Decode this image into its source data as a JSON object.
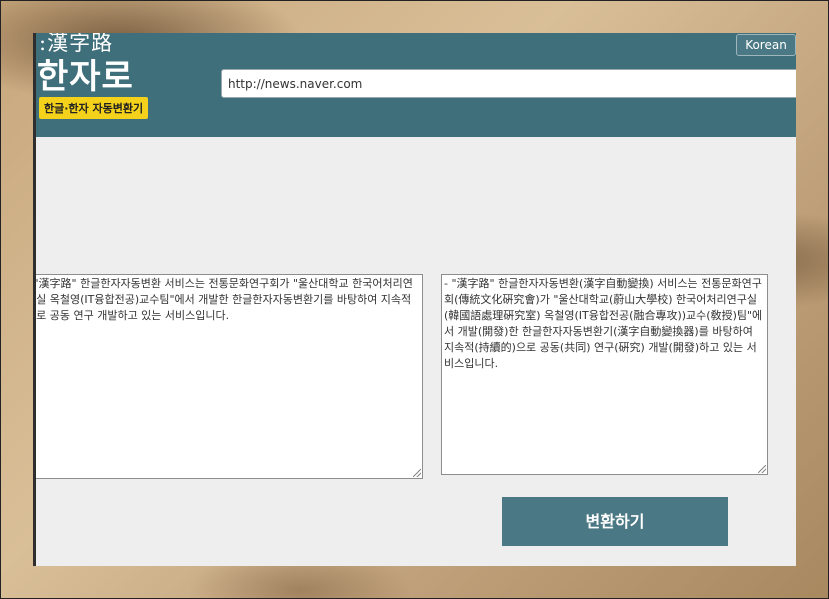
{
  "header": {
    "logo_hanja": ":漢字路",
    "logo_main": "한자로",
    "logo_badge": "한글·한자 자동변환기",
    "lang_button": "Korean"
  },
  "url": {
    "value": "http://news.naver.com"
  },
  "input_text": "- \"漢字路\" 한글한자자동변환 서비스는 전통문화연구회가 \"울산대학교 한국어처리연구실 옥철영(IT융합전공)교수팀\"에서 개발한 한글한자자동변환기를 바탕하여 지속적으로 공동 연구 개발하고 있는 서비스입니다.",
  "output_text": "- \"漢字路\" 한글한자자동변환(漢字自動變換) 서비스는 전통문화연구회(傳統文化硏究會)가 \"울산대학교(蔚山大學校) 한국어처리연구실(韓國語處理硏究室) 옥철영(IT융합전공(融合專攻))교수(敎授)팀\"에서 개발(開發)한 한글한자자동변환기(漢字自動變換器)를 바탕하여 지속적(持續的)으로 공동(共同) 연구(硏究) 개발(開發)하고 있는 서비스입니다.",
  "convert_button": "변환하기"
}
